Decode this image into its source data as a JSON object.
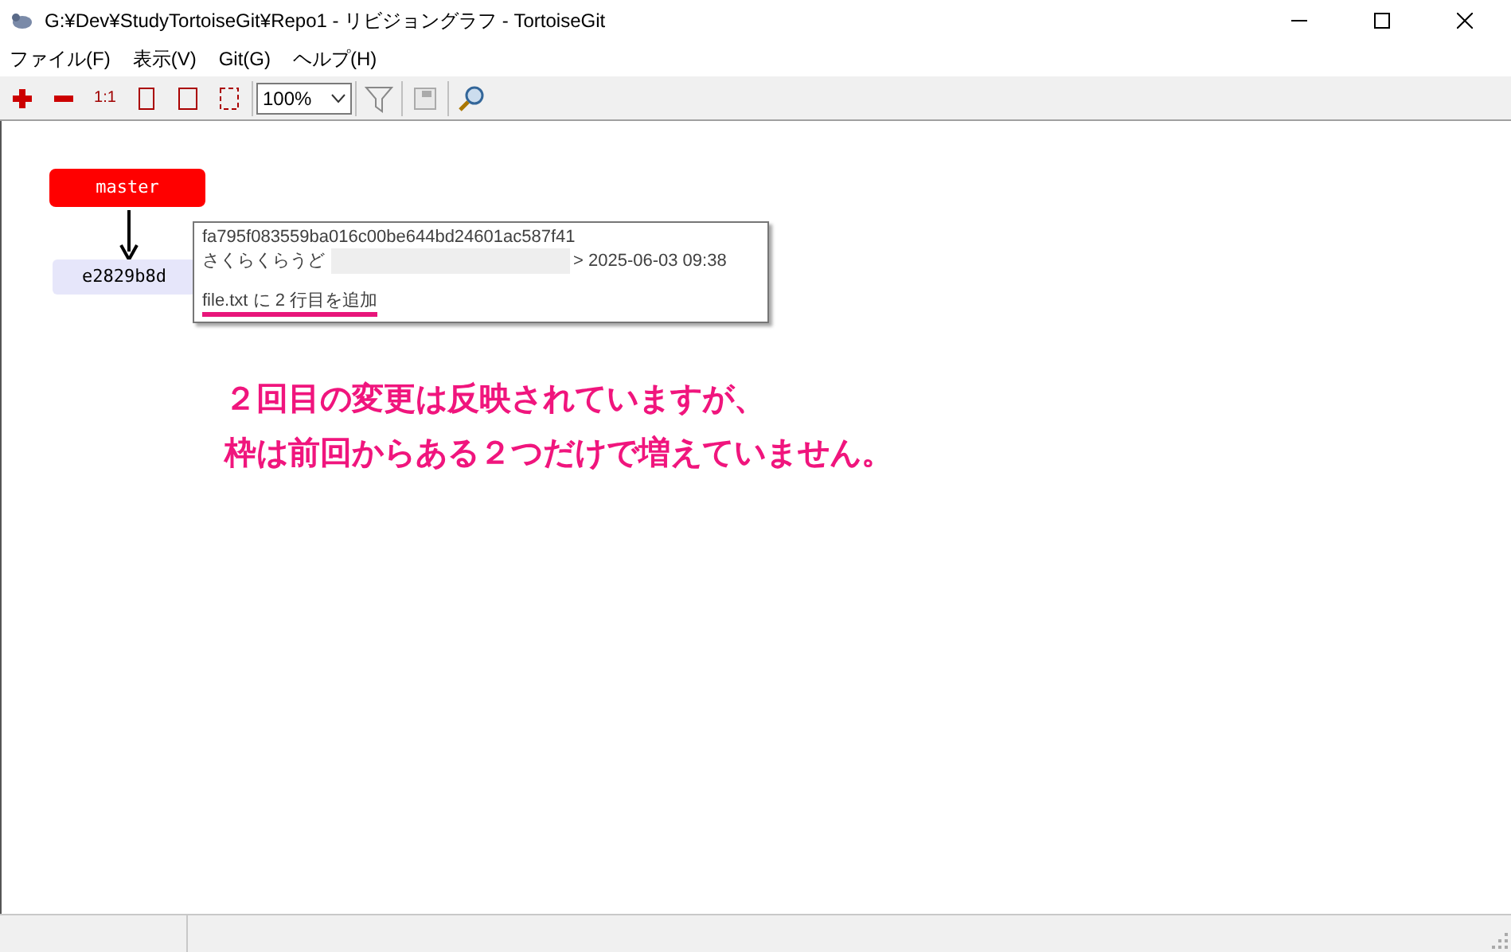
{
  "window": {
    "title": "G:¥Dev¥StudyTortoiseGit¥Repo1 - リビジョングラフ - TortoiseGit"
  },
  "menu": [
    "ファイル(F)",
    "表示(V)",
    "Git(G)",
    "ヘルプ(H)"
  ],
  "toolbar": {
    "zoom_in_label": "1:1",
    "zoom": "100%"
  },
  "graph": {
    "branch": "master",
    "commit": "e2829b8d"
  },
  "tooltip": {
    "hash": "fa795f083559ba016c00be644bd24601ac587f41",
    "author": "さくらくらうど",
    "date": "> 2025-06-03 09:38",
    "message": "file.txt に 2 行目を追加"
  },
  "annotation": [
    "２回目の変更は反映されていますが、",
    "枠は前回からある２つだけで増えていません。"
  ]
}
